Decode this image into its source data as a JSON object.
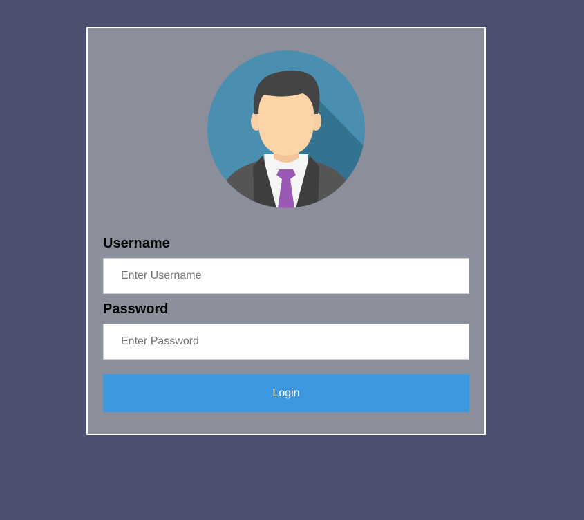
{
  "login": {
    "username_label": "Username",
    "username_placeholder": "Enter Username",
    "password_label": "Password",
    "password_placeholder": "Enter Password",
    "login_label": "Login"
  },
  "icons": {
    "avatar": "user-avatar-icon"
  },
  "colors": {
    "page_background": "#4a506e",
    "card_background": "#8b8e9b",
    "card_border": "#ffffff",
    "button_background": "#3e98df",
    "avatar_background": "#4a8fb0",
    "tie": "#9b59b6"
  }
}
